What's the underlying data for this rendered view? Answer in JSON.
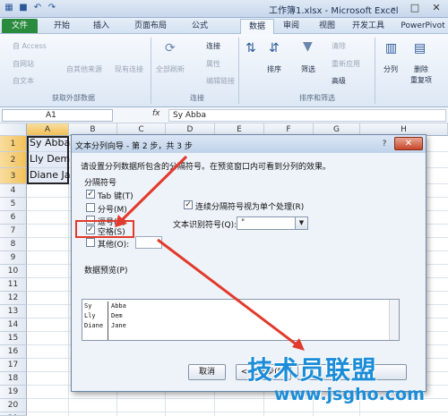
{
  "window": {
    "title": "工作簿1.xlsx - Microsoft Excel",
    "controls": {
      "minimize": "–",
      "maximize": "□",
      "close": "✕"
    }
  },
  "ribbon_tabs": [
    {
      "label": "文件"
    },
    {
      "label": "开始"
    },
    {
      "label": "插入"
    },
    {
      "label": "页面布局"
    },
    {
      "label": "公式"
    },
    {
      "label": "数据"
    },
    {
      "label": "审阅"
    },
    {
      "label": "视图"
    },
    {
      "label": "开发工具"
    },
    {
      "label": "PowerPivot"
    }
  ],
  "ribbon": {
    "get_external": {
      "from_access": "自 Access",
      "from_web": "自网站",
      "from_text": "自文本",
      "from_other": "自其他来源",
      "existing": "现有连接",
      "group": "获取外部数据"
    },
    "connections": {
      "refresh_all": "全部刷新",
      "connections": "连接",
      "properties": "属性",
      "edit_links": "编辑链接",
      "group": "连接"
    },
    "sort_filter": {
      "sort": "排序",
      "filter": "筛选",
      "clear": "清除",
      "reapply": "重新应用",
      "advanced": "高级",
      "group": "排序和筛选"
    },
    "data_tools": {
      "text_to_columns": "分列",
      "remove_dup_1": "删除",
      "remove_dup_2": "重复项"
    }
  },
  "formula_bar": {
    "name_box": "A1",
    "fx": "fx",
    "content": "Sy Abba"
  },
  "columns": [
    "A",
    "B",
    "C",
    "D",
    "E",
    "F",
    "G",
    "H"
  ],
  "rows": [
    "1",
    "2",
    "3",
    "4",
    "5",
    "6",
    "7",
    "8",
    "9",
    "10",
    "11",
    "12",
    "13",
    "14",
    "15",
    "16",
    "17",
    "18",
    "19",
    "20",
    "21"
  ],
  "cells": {
    "a1": "Sy Abba",
    "a2": "Lly Dem",
    "a3": "Diane Ja"
  },
  "dialog": {
    "title": "文本分列向导 - 第 2 步，共 3 步",
    "help": "?",
    "close": "✕",
    "instruction": "请设置分列数据所包含的分隔符号。在预览窗口内可看到分列的效果。",
    "delimiters_label": "分隔符号",
    "delimiters": {
      "tab": {
        "label": "Tab 键(T)",
        "checked": "✓"
      },
      "semicolon": {
        "label": "分号(M)"
      },
      "comma": {
        "label": "逗号(C)"
      },
      "space": {
        "label": "空格(S)",
        "checked": "✓"
      },
      "other": {
        "label": "其他(O):"
      }
    },
    "consecutive": {
      "label": "连续分隔符号视为单个处理(R)",
      "checked": "✓"
    },
    "qualifier_label": "文本识别符号(Q):",
    "qualifier_value": "\"",
    "qualifier_arrow": "▼",
    "preview_label": "数据预览(P)",
    "preview": [
      {
        "c1": "Sy",
        "c2": "Abba"
      },
      {
        "c1": "Lly",
        "c2": "Dem"
      },
      {
        "c1": "Diane",
        "c2": "Jane"
      }
    ],
    "buttons": {
      "cancel": "取消",
      "back": "< 上一步(B)"
    }
  },
  "watermark": {
    "main": "技术员联盟",
    "url": "www.jsgho.com"
  },
  "colors": {
    "excel_green": "#2a8a3e",
    "highlight_red": "#e23a2c",
    "watermark_blue": "#1a8cd8"
  }
}
